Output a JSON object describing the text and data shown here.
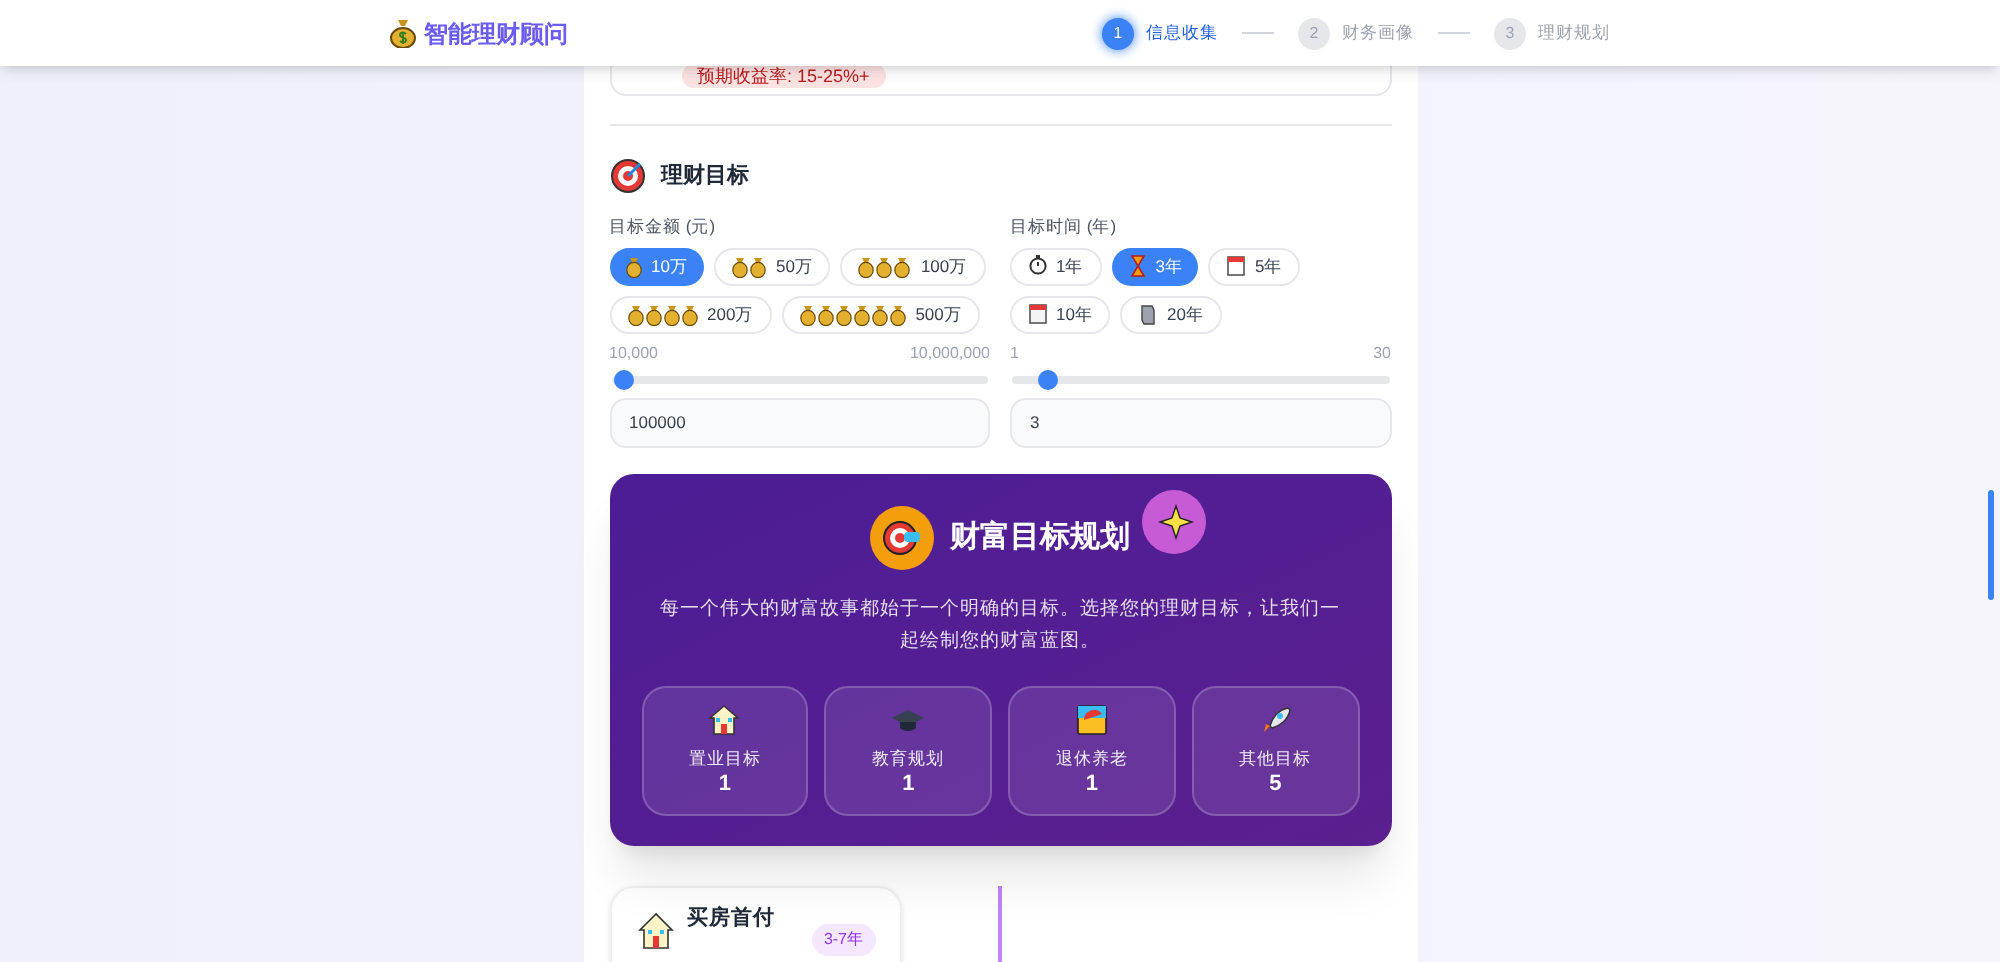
{
  "header": {
    "app_title": "智能理财顾问",
    "steps": [
      {
        "number": "1",
        "label": "信息收集",
        "selected": true
      },
      {
        "number": "2",
        "label": "财务画像",
        "selected": false
      },
      {
        "number": "3",
        "label": "理财规划",
        "selected": false
      }
    ]
  },
  "previous_card": {
    "tag": "预期收益率: 15-25%+"
  },
  "goal_section": {
    "title": "理财目标",
    "amount": {
      "label": "目标金额 (元)",
      "options": [
        {
          "label": "10万",
          "selected": true
        },
        {
          "label": "50万",
          "selected": false
        },
        {
          "label": "100万",
          "selected": false
        },
        {
          "label": "200万",
          "selected": false
        },
        {
          "label": "500万",
          "selected": false
        }
      ],
      "min": "10,000",
      "max": "10,000,000",
      "level": 0.01,
      "value": "100000"
    },
    "time": {
      "label": "目标时间 (年)",
      "options": [
        {
          "label": "1年",
          "selected": false
        },
        {
          "label": "3年",
          "selected": true
        },
        {
          "label": "5年",
          "selected": false
        },
        {
          "label": "10年",
          "selected": false
        },
        {
          "label": "20年",
          "selected": false
        }
      ],
      "min": "1",
      "max": "30",
      "level": 0.07,
      "value": "3"
    }
  },
  "banner": {
    "title": "财富目标规划",
    "description": "每一个伟大的财富故事都始于一个明确的目标。选择您的理财目标，让我们一起绘制您的财富蓝图。",
    "stats": [
      {
        "label": "置业目标",
        "count": "1"
      },
      {
        "label": "教育规划",
        "count": "1"
      },
      {
        "label": "退休养老",
        "count": "1"
      },
      {
        "label": "其他目标",
        "count": "5"
      }
    ]
  },
  "goal_cards": [
    {
      "title": "买房首付",
      "badge": "3-7年"
    }
  ]
}
